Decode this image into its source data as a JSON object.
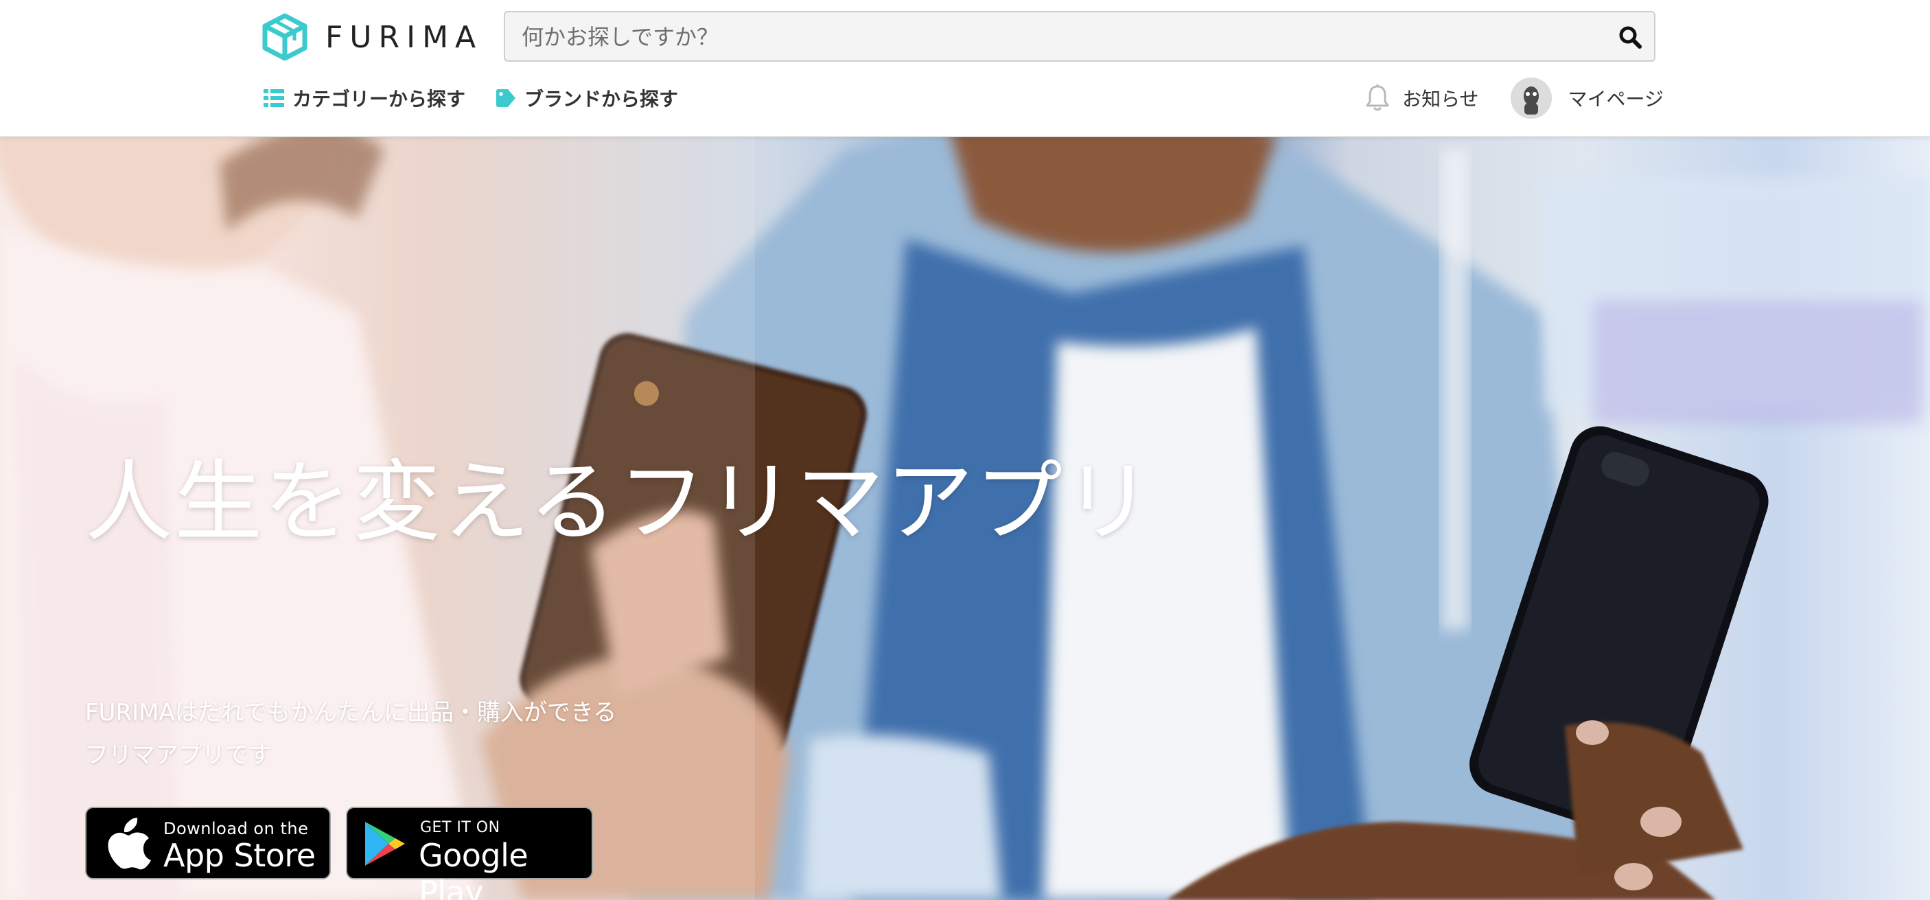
{
  "brand": {
    "name": "FURIMA",
    "accent": "#3ccace"
  },
  "search": {
    "placeholder": "何かお探しですか？",
    "icon": "search-icon"
  },
  "nav": {
    "category": {
      "label": "カテゴリーから探す",
      "icon": "list-icon"
    },
    "brand": {
      "label": "ブランドから探す",
      "icon": "tag-icon"
    }
  },
  "user_menu": {
    "notice": {
      "label": "お知らせ",
      "icon": "bell-icon"
    },
    "mypage": {
      "label": "マイページ",
      "icon": "avatar"
    }
  },
  "hero": {
    "title": "人生を変えるフリマアプリ",
    "subtitle_line1": "FURIMAはだれでもかんたんに出品・購入ができる",
    "subtitle_line2": "フリマアプリです"
  },
  "stores": {
    "apple": {
      "small": "Download on the",
      "big": "App Store",
      "icon": "apple-icon"
    },
    "google": {
      "small": "GET IT ON",
      "big": "Google Play",
      "icon": "google-play-icon"
    }
  }
}
